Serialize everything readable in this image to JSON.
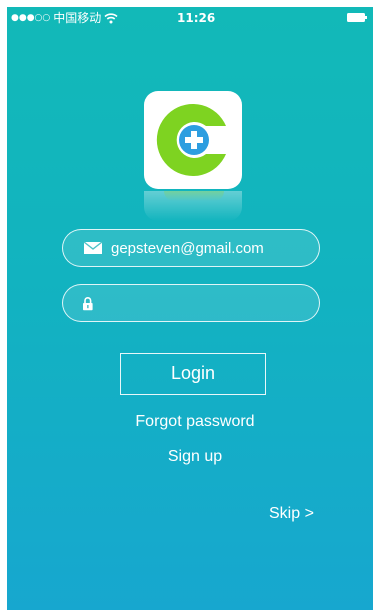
{
  "status_bar": {
    "signal": "●●●○○",
    "carrier": "中国移动",
    "time": "11:26"
  },
  "logo": {
    "icon": "app-logo-icon",
    "colors": {
      "green": "#7ed321",
      "blue": "#2d9ee0",
      "background": "#ffffff"
    }
  },
  "login_form": {
    "email_value": "gepsteven@gmail.com",
    "email_icon": "envelope-icon",
    "password_value": "",
    "password_icon": "lock-icon",
    "login_label": "Login",
    "forgot_label": "Forgot password",
    "signup_label": "Sign up",
    "skip_label": "Skip >"
  },
  "colors": {
    "background_top": "#12b9b8",
    "background_bottom": "#17a7cf",
    "text": "#ffffff"
  }
}
